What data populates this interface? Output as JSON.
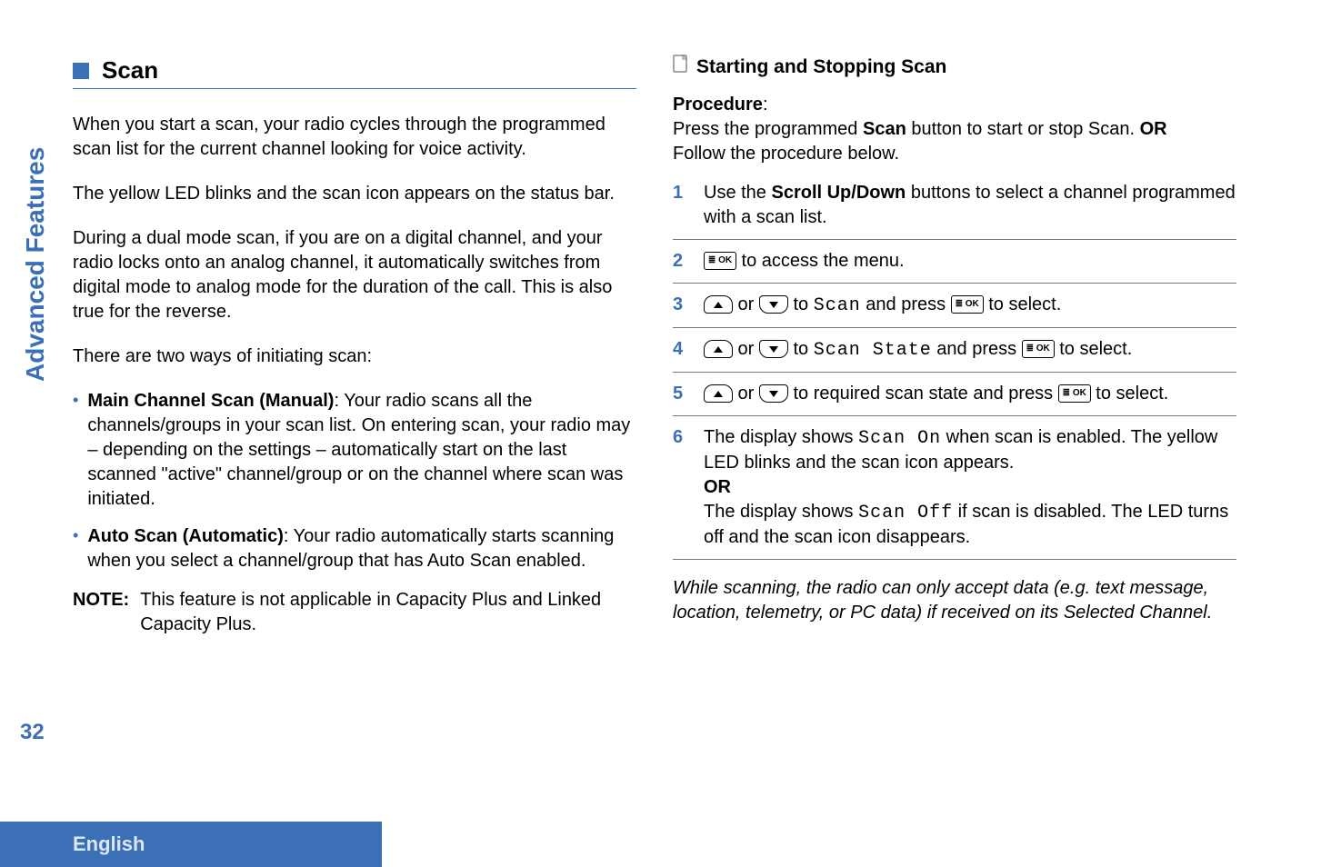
{
  "sidebar_label": "Advanced Features",
  "page_number": "32",
  "footer_language": "English",
  "left": {
    "heading": "Scan",
    "p1": "When you start a scan, your radio cycles through the programmed scan list for the current channel looking for voice activity.",
    "p2": "The yellow LED blinks and the scan icon appears on the status bar.",
    "p3": "During a dual mode scan, if you are on a digital channel, and your radio locks onto an analog channel, it automatically switches from digital mode to analog mode for the duration of the call. This is also true for the reverse.",
    "p4": "There are two ways of initiating scan:",
    "b1_bold": "Main Channel Scan (Manual)",
    "b1_rest": ": Your radio scans all the channels/groups in your scan list. On entering scan, your radio may – depending on the settings – automatically start on the last scanned \"active\" channel/group or on the channel where scan was initiated.",
    "b2_bold": "Auto Scan (Automatic)",
    "b2_rest": ": Your radio automatically starts scanning when you select a channel/group that has Auto Scan enabled.",
    "note_label": "NOTE:",
    "note_text": "This feature is not applicable in Capacity Plus and Linked Capacity Plus."
  },
  "right": {
    "subheading": "Starting and Stopping Scan",
    "proc_label": "Procedure",
    "proc_colon": ":",
    "proc_intro_a": "Press the programmed ",
    "proc_intro_scan": "Scan",
    "proc_intro_b": " button to start or stop Scan. ",
    "proc_or": "OR",
    "proc_follow": "Follow the procedure below.",
    "s1_a": "Use the ",
    "s1_bold": "Scroll Up/Down",
    "s1_b": " buttons to select a channel programmed with a scan list.",
    "s2": " to access the menu.",
    "s3_a": " or ",
    "s3_b": " to ",
    "s3_scan": "Scan",
    "s3_c": " and press ",
    "s3_d": " to select.",
    "s4_a": " or ",
    "s4_b": " to ",
    "s4_state": "Scan State",
    "s4_c": " and press ",
    "s4_d": " to select.",
    "s5_a": " or ",
    "s5_b": " to required scan state and press ",
    "s5_c": " to select.",
    "s6_a": "The display shows ",
    "s6_on": "Scan On",
    "s6_b": " when scan is enabled. The yellow LED blinks and the scan icon appears.",
    "s6_or": "OR",
    "s6_c": "The display shows ",
    "s6_off": "Scan Off",
    "s6_d": " if scan is disabled. The LED turns off and the scan icon disappears.",
    "tail": "While scanning, the radio can only accept data (e.g. text message, location, telemetry, or PC data) if received on its Selected Channel."
  },
  "icons": {
    "ok_key": "≣ OK"
  }
}
